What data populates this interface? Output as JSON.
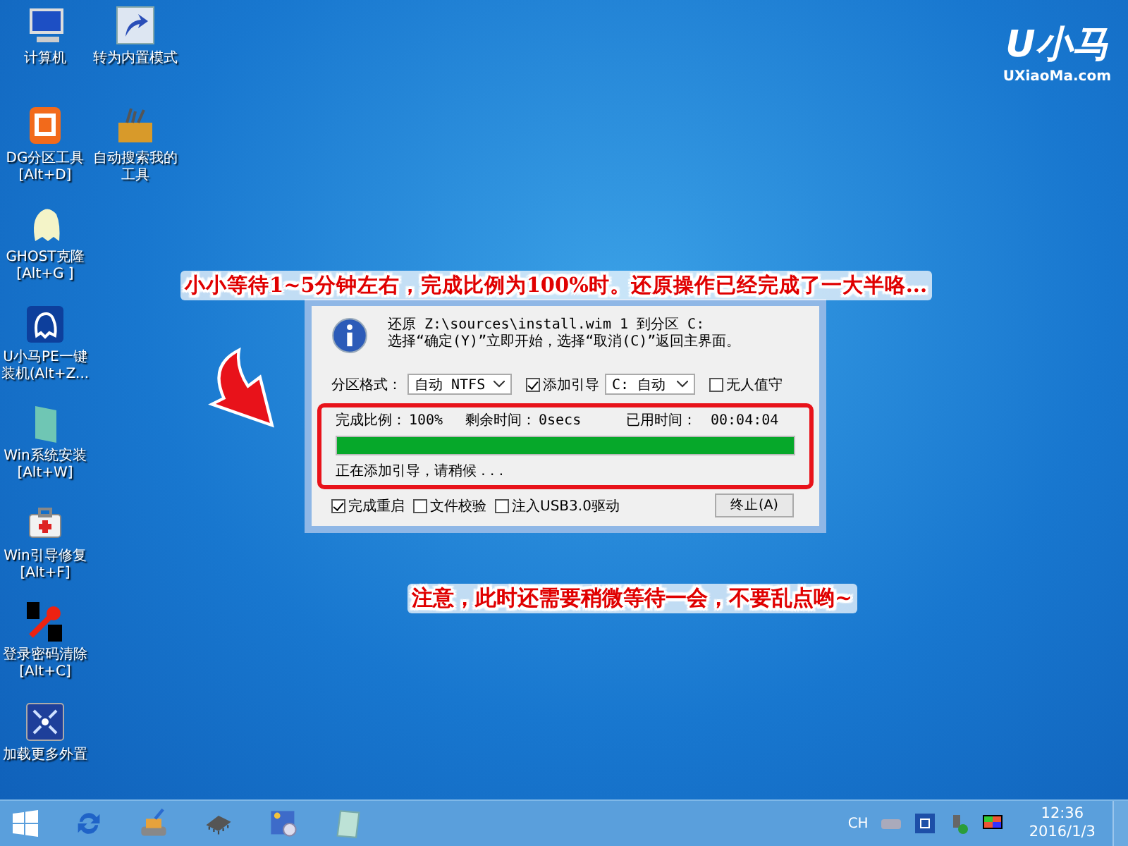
{
  "desktop_icons": [
    [
      {
        "kind": "computer",
        "lines": [
          "计算机"
        ]
      },
      {
        "kind": "partition",
        "lines": [
          "DG分区工具",
          "[Alt+D]"
        ]
      },
      {
        "kind": "ghost",
        "lines": [
          "GHOST克隆",
          "[Alt+G ]"
        ]
      },
      {
        "kind": "installer",
        "lines": [
          "U小马PE一键",
          "装机(Alt+Z..."
        ]
      },
      {
        "kind": "setup",
        "lines": [
          "Win系统安装",
          "[Alt+W]"
        ]
      },
      {
        "kind": "repair",
        "lines": [
          "Win引导修复",
          "[Alt+F]"
        ]
      },
      {
        "kind": "password",
        "lines": [
          "登录密码清除",
          "[Alt+C]"
        ]
      },
      {
        "kind": "more",
        "lines": [
          "加载更多外置"
        ]
      }
    ],
    [
      {
        "kind": "shortcut",
        "lines": [
          "转为内置模式"
        ]
      },
      {
        "kind": "toolbox",
        "lines": [
          "自动搜索我的",
          "工具"
        ]
      }
    ]
  ],
  "logo": {
    "title": "U小马",
    "subtitle": "UXiaoMa.com"
  },
  "caption": "小小等待1~5分钟左右，完成比例为100%时。还原操作已经完成了一大半咯...",
  "note": "注意，此时还需要稍微等待一会，不要乱点哟~",
  "dialog": {
    "message": [
      "还原 Z:\\sources\\install.wim 1 到分区 C:",
      "选择“确定(Y)”立即开始，选择“取消(C)”返回主界面。"
    ],
    "format_label": "分区格式：",
    "format_value": "自动 NTFS",
    "add_boot": {
      "label": "添加引导",
      "checked": true
    },
    "boot_value": "C: 自动",
    "unattended": {
      "label": "无人值守",
      "checked": false
    },
    "progress": {
      "done_label": "完成比例：",
      "done": "100%",
      "remain_label": "剩余时间：",
      "remain": "0secs",
      "elapsed_label": "已用时间：",
      "elapsed": "00:04:04",
      "level": 1,
      "status": "正在添加引导，请稍候 . . ."
    },
    "options": [
      {
        "label": "完成重启",
        "checked": true
      },
      {
        "label": "文件校验",
        "checked": false
      },
      {
        "label": "注入USB3.0驱动",
        "checked": false
      }
    ],
    "stop_button": "终止(A)"
  },
  "taskbar": {
    "language": "CH",
    "time": "12:36",
    "date": "2016/1/3"
  }
}
